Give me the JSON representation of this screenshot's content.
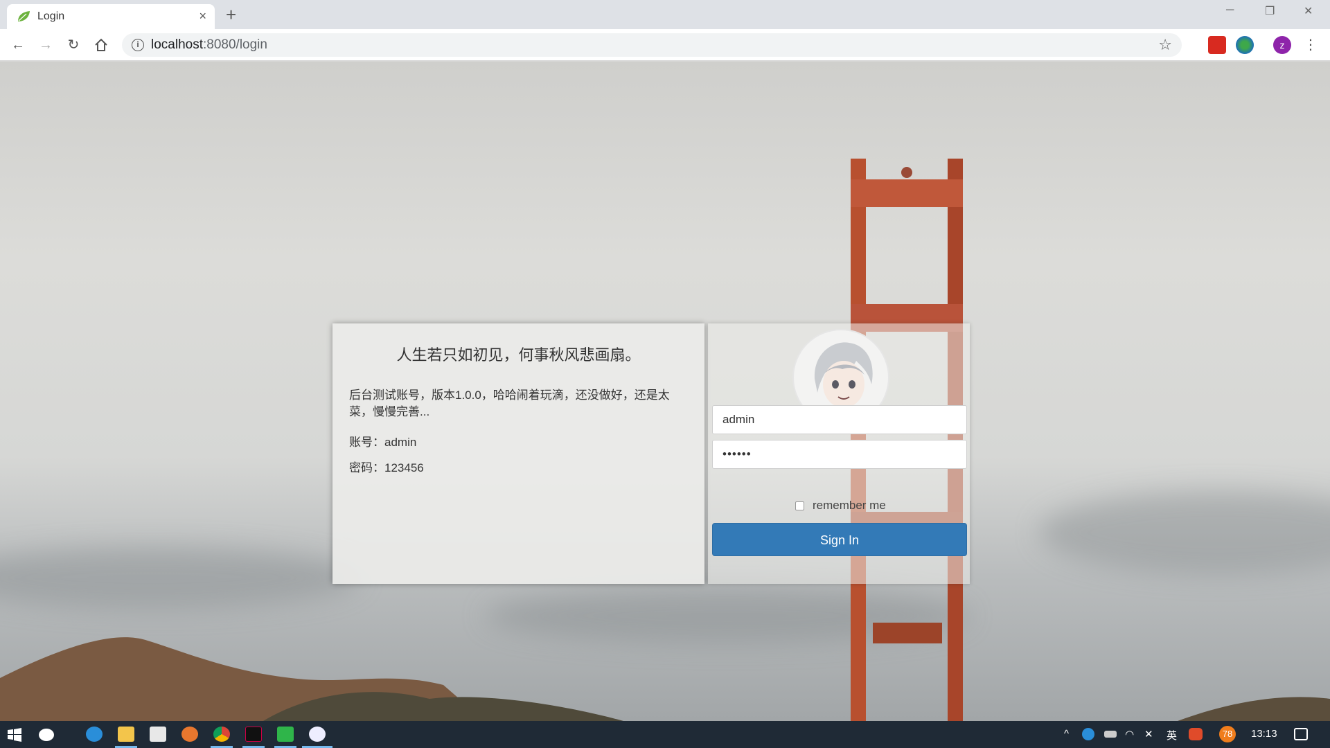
{
  "browser": {
    "tab_title": "Login",
    "url_host": "localhost",
    "url_rest": ":8080/login",
    "new_tab_glyph": "+",
    "close_glyph": "×"
  },
  "page": {
    "poem": "人生若只如初见，何事秋风悲画扇。",
    "description": "后台测试账号，版本1.0.0，哈哈闹着玩滴，还没做好，还是太菜，慢慢完善...",
    "account_line": "账号：admin",
    "password_line": "密码：123456"
  },
  "login": {
    "username_value": "admin",
    "password_value": "••••••",
    "remember_label": "remember me",
    "signin_label": "Sign In"
  },
  "taskbar": {
    "ime": "英",
    "badge": "78",
    "time": "13:13"
  },
  "colors": {
    "primary_button": "#337ab7",
    "taskbar": "#1f2a36"
  }
}
